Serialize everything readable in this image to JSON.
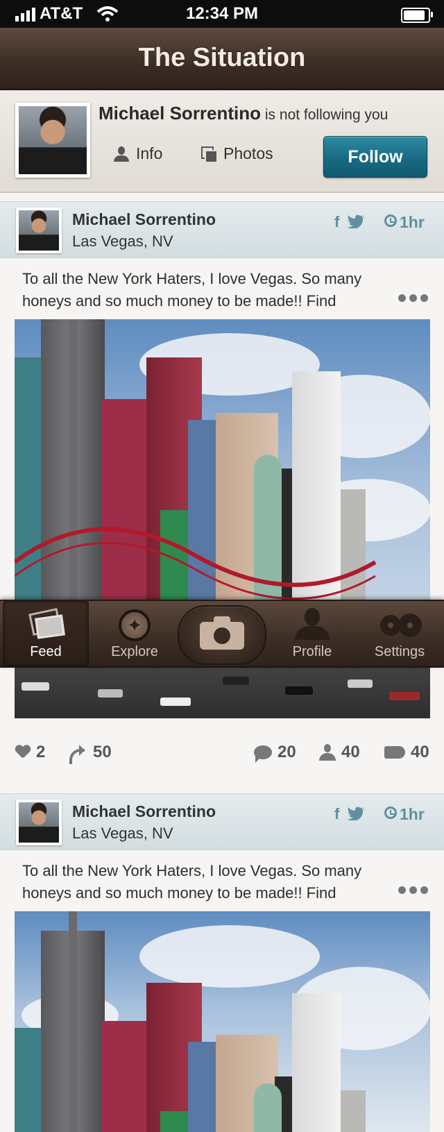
{
  "status_bar": {
    "carrier": "AT&T",
    "time": "12:34 PM"
  },
  "nav": {
    "title": "The Situation"
  },
  "profile": {
    "name": "Michael Sorrentino",
    "follow_status": "is not following you",
    "tabs": [
      {
        "label": "Info",
        "icon": "user-icon"
      },
      {
        "label": "Photos",
        "icon": "photos-icon"
      }
    ],
    "follow_label": "Follow",
    "follow_color": "#176b83"
  },
  "posts": [
    {
      "author": "Michael Sorrentino",
      "location": "Las Vegas, NV",
      "social_facebook": "f",
      "time": "1hr",
      "text": "To all the New York Haters, I love Vegas. So many honeys and so much money to be made!! Find",
      "likes": "2",
      "reposts": "50",
      "comments": "20",
      "people": "40",
      "tags": "40"
    },
    {
      "author": "Michael Sorrentino",
      "location": "Las Vegas, NV",
      "social_facebook": "f",
      "time": "1hr",
      "text": "To all the New York Haters, I love Vegas. So many honeys and so much money to be made!! Find"
    }
  ],
  "tabbar": {
    "items": [
      {
        "label": "Feed",
        "icon": "feed-icon",
        "active": true
      },
      {
        "label": "Explore",
        "icon": "compass-icon"
      },
      {
        "label": "",
        "icon": "camera-icon"
      },
      {
        "label": "Profile",
        "icon": "profile-icon"
      },
      {
        "label": "Settings",
        "icon": "gears-icon"
      }
    ]
  },
  "colors": {
    "nav_brown": "#3c2d24",
    "accent_teal": "#176b83",
    "link_blue": "#5f8fa0"
  }
}
